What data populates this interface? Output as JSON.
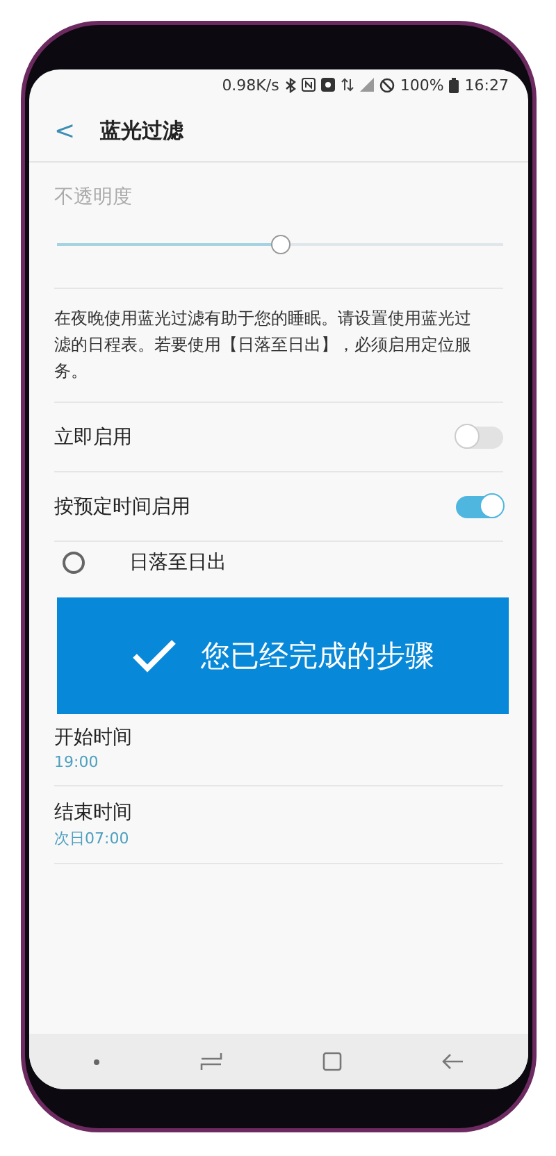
{
  "status_bar": {
    "speed": "0.98K/s",
    "battery": "100%",
    "time": "16:27"
  },
  "header": {
    "back": "<",
    "title": "蓝光过滤"
  },
  "opacity": {
    "label": "不透明度",
    "level": 0.5
  },
  "description": "在夜晚使用蓝光过滤有助于您的睡眠。请设置使用蓝光过滤的日程表。若要使用【日落至日出】，必须启用定位服务。",
  "switches": [
    {
      "label": "立即启用",
      "on": false
    },
    {
      "label": "按预定时间启用",
      "on": true
    }
  ],
  "schedule_options": [
    {
      "label": "日落至日出",
      "selected": false
    }
  ],
  "times": [
    {
      "label": "开始时间",
      "value": "19:00"
    },
    {
      "label": "结束时间",
      "value": "次日07:00"
    }
  ],
  "banner": {
    "text": "您已经完成的步骤"
  }
}
